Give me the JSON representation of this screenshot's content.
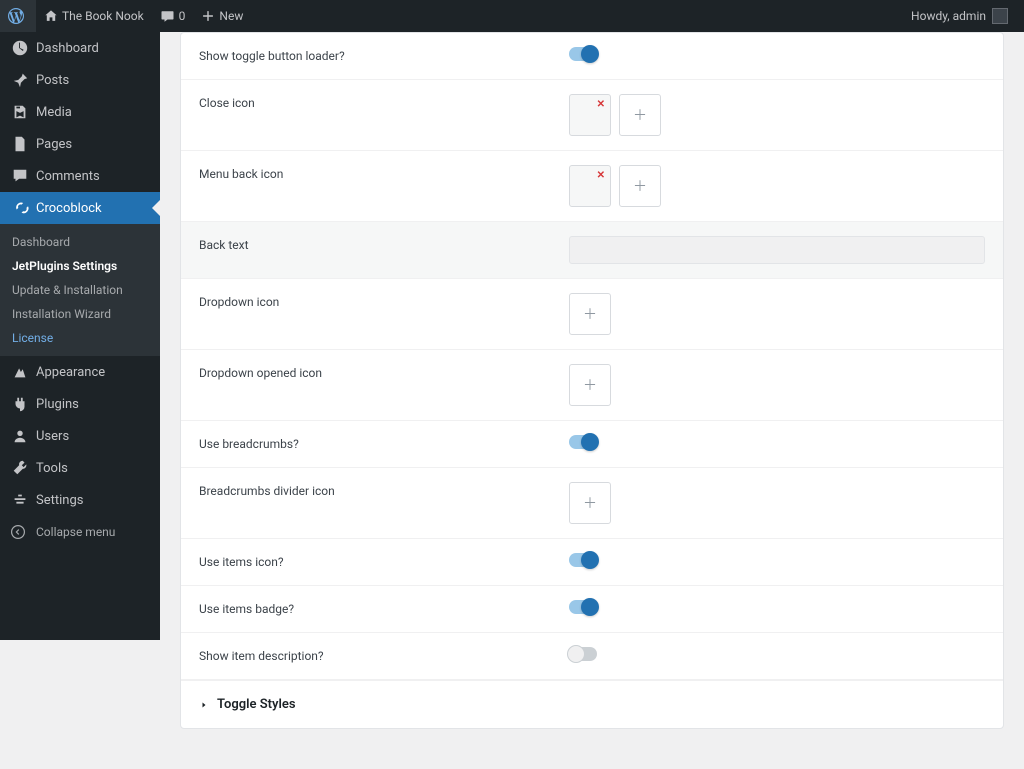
{
  "adminbar": {
    "site_name": "The Book Nook",
    "comments_count": "0",
    "new_label": "New",
    "greeting": "Howdy, admin"
  },
  "sidebar": {
    "items": [
      {
        "label": "Dashboard",
        "icon": "dashboard-icon"
      },
      {
        "label": "Posts",
        "icon": "pin-icon"
      },
      {
        "label": "Media",
        "icon": "media-icon"
      },
      {
        "label": "Pages",
        "icon": "page-icon"
      },
      {
        "label": "Comments",
        "icon": "comment-icon"
      },
      {
        "label": "Crocoblock",
        "icon": "crocoblock-icon"
      },
      {
        "label": "Appearance",
        "icon": "appearance-icon"
      },
      {
        "label": "Plugins",
        "icon": "plugin-icon"
      },
      {
        "label": "Users",
        "icon": "users-icon"
      },
      {
        "label": "Tools",
        "icon": "tools-icon"
      },
      {
        "label": "Settings",
        "icon": "settings-icon"
      }
    ],
    "submenu": [
      {
        "label": "Dashboard"
      },
      {
        "label": "JetPlugins Settings"
      },
      {
        "label": "Update & Installation"
      },
      {
        "label": "Installation Wizard"
      },
      {
        "label": "License"
      }
    ],
    "collapse": "Collapse menu"
  },
  "settings": {
    "rows": [
      {
        "label": "Show toggle button loader?",
        "type": "switch",
        "on": true
      },
      {
        "label": "Close icon",
        "type": "iconpair"
      },
      {
        "label": "Menu back icon",
        "type": "iconpair"
      },
      {
        "label": "Back text",
        "type": "text",
        "highlight": true
      },
      {
        "label": "Dropdown icon",
        "type": "iconsingle"
      },
      {
        "label": "Dropdown opened icon",
        "type": "iconsingle"
      },
      {
        "label": "Use breadcrumbs?",
        "type": "switch",
        "on": true
      },
      {
        "label": "Breadcrumbs divider icon",
        "type": "iconsingle"
      },
      {
        "label": "Use items icon?",
        "type": "switch",
        "on": true
      },
      {
        "label": "Use items badge?",
        "type": "switch",
        "on": true
      },
      {
        "label": "Show item description?",
        "type": "switch",
        "on": false
      }
    ],
    "section_header": "Toggle Styles"
  }
}
